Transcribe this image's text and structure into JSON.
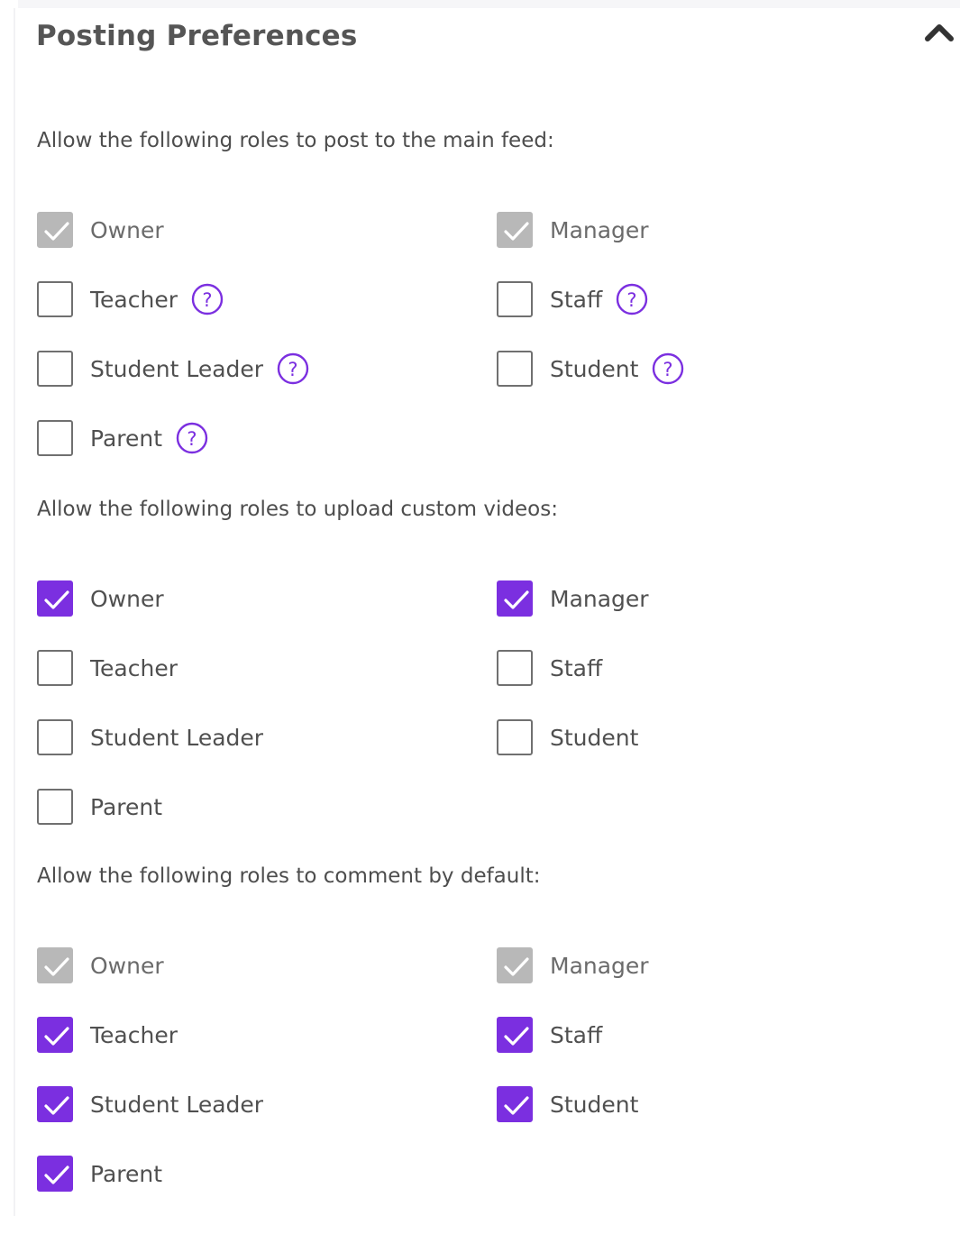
{
  "title": "Posting Preferences",
  "accent_color": "#7b2fe0",
  "disabled_color": "#b8b8b8",
  "collapse_icon": "chevron-up-icon",
  "help_icon": "question-circle-icon",
  "sections": [
    {
      "label": "Allow the following roles to post to the main feed:",
      "options": [
        {
          "label": "Owner",
          "state": "locked-checked",
          "help": false
        },
        {
          "label": "Manager",
          "state": "locked-checked",
          "help": false
        },
        {
          "label": "Teacher",
          "state": "unchecked",
          "help": true
        },
        {
          "label": "Staff",
          "state": "unchecked",
          "help": true
        },
        {
          "label": "Student Leader",
          "state": "unchecked",
          "help": true
        },
        {
          "label": "Student",
          "state": "unchecked",
          "help": true
        },
        {
          "label": "Parent",
          "state": "unchecked",
          "help": true
        }
      ]
    },
    {
      "label": "Allow the following roles to upload custom videos:",
      "options": [
        {
          "label": "Owner",
          "state": "checked",
          "help": false
        },
        {
          "label": "Manager",
          "state": "checked",
          "help": false
        },
        {
          "label": "Teacher",
          "state": "unchecked",
          "help": false
        },
        {
          "label": "Staff",
          "state": "unchecked",
          "help": false
        },
        {
          "label": "Student Leader",
          "state": "unchecked",
          "help": false
        },
        {
          "label": "Student",
          "state": "unchecked",
          "help": false
        },
        {
          "label": "Parent",
          "state": "unchecked",
          "help": false
        }
      ]
    },
    {
      "label": "Allow the following roles to comment by default:",
      "options": [
        {
          "label": "Owner",
          "state": "locked-checked",
          "help": false
        },
        {
          "label": "Manager",
          "state": "locked-checked",
          "help": false
        },
        {
          "label": "Teacher",
          "state": "checked",
          "help": false
        },
        {
          "label": "Staff",
          "state": "checked",
          "help": false
        },
        {
          "label": "Student Leader",
          "state": "checked",
          "help": false
        },
        {
          "label": "Student",
          "state": "checked",
          "help": false
        },
        {
          "label": "Parent",
          "state": "checked",
          "help": false
        }
      ]
    }
  ]
}
